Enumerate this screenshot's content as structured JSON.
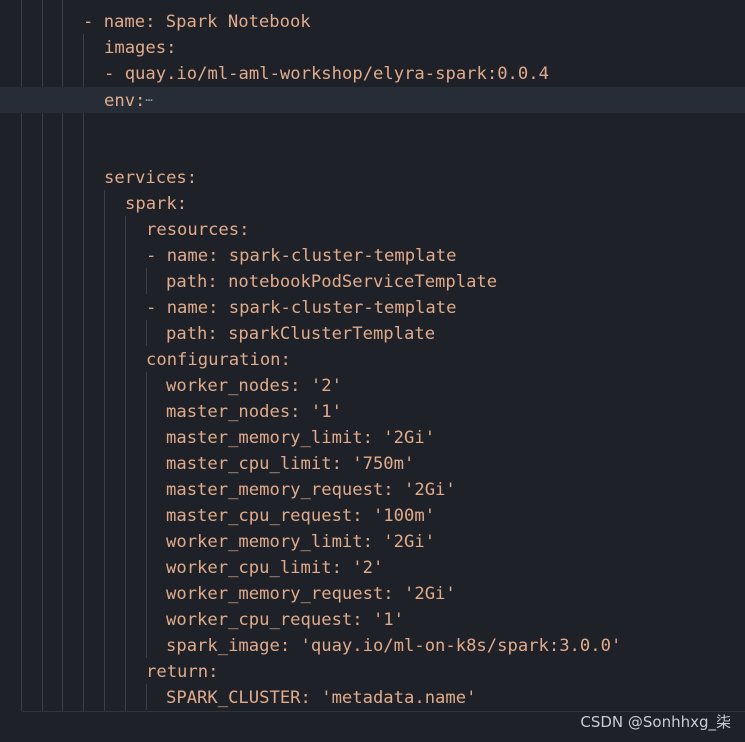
{
  "editor": {
    "lines": [
      "- name: Spark Notebook",
      "images:",
      "- quay.io/ml-aml-workshop/elyra-spark:0.0.4",
      "env:",
      "",
      "",
      "services:",
      "spark:",
      "resources:",
      "- name: spark-cluster-template",
      "path: notebookPodServiceTemplate",
      "- name: spark-cluster-template",
      "path: sparkClusterTemplate",
      "configuration:",
      "worker_nodes: '2'",
      "master_nodes: '1'",
      "master_memory_limit: '2Gi'",
      "master_cpu_limit: '750m'",
      "master_memory_request: '2Gi'",
      "master_cpu_request: '100m'",
      "worker_memory_limit: '2Gi'",
      "worker_cpu_limit: '2'",
      "worker_memory_request: '2Gi'",
      "worker_cpu_request: '1'",
      "spark_image: 'quay.io/ml-on-k8s/spark:3.0.0'",
      "return:",
      "SPARK_CLUSTER: 'metadata.name'"
    ],
    "folded_marker": "⋯"
  },
  "watermark": "CSDN @Sonhhxg_柒"
}
